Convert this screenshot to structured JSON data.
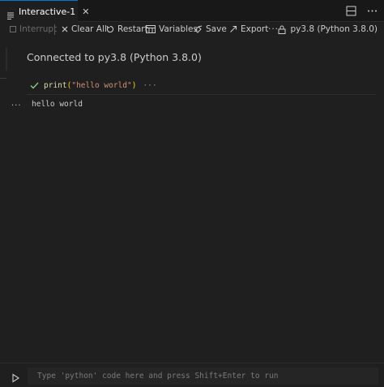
{
  "tab": {
    "label": "Interactive-1",
    "close_glyph": "✕"
  },
  "toolbar": {
    "interrupt": "Interrupt",
    "clear_all": "Clear All",
    "restart": "Restart",
    "variables": "Variables",
    "save": "Save",
    "export": "Export",
    "more": "···",
    "kernel": "py3.8 (Python 3.8.0)"
  },
  "output": {
    "connected": "Connected to py3.8 (Python 3.8.0)",
    "code": {
      "fn": "print",
      "open": "(",
      "str": "\"hello world\"",
      "close": ")",
      "more": "···"
    },
    "more": "···",
    "result": "hello world"
  },
  "input": {
    "placeholder": "Type 'python' code here and press Shift+Enter to run"
  },
  "colors": {
    "accent": "#0078d4",
    "success": "#89d185",
    "function": "#dcdcaa",
    "string": "#ce9178"
  },
  "icons": [
    "file-lines-icon",
    "close-icon",
    "split-editor-icon",
    "more-icon",
    "stop-icon",
    "clear-icon",
    "restart-icon",
    "variables-icon",
    "save-icon",
    "export-icon",
    "kernel-icon",
    "check-icon",
    "play-icon"
  ]
}
